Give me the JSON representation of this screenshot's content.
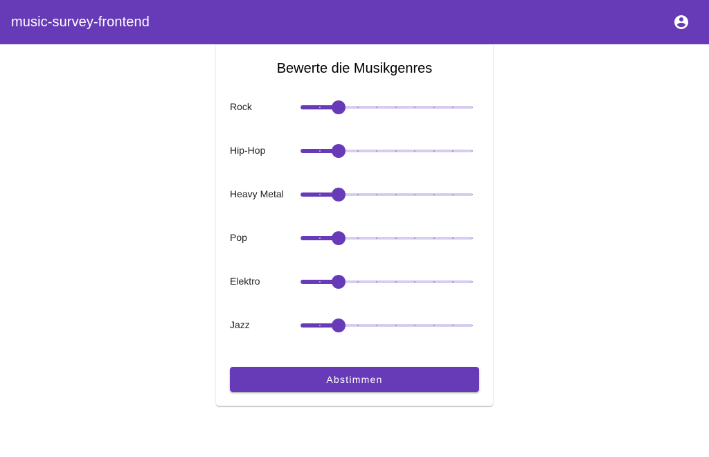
{
  "header": {
    "title": "music-survey-frontend",
    "account_icon": "account-circle-icon"
  },
  "form": {
    "title": "Bewerte die Musikgenres",
    "slider_scale": {
      "min": 0,
      "max": 9,
      "step": 1
    },
    "genres": [
      {
        "label": "Rock",
        "value": 2
      },
      {
        "label": "Hip-Hop",
        "value": 2
      },
      {
        "label": "Heavy Metal",
        "value": 2
      },
      {
        "label": "Pop",
        "value": 2
      },
      {
        "label": "Elektro",
        "value": 2
      },
      {
        "label": "Jazz",
        "value": 2
      }
    ],
    "submit_label": "Abstimmen"
  },
  "colors": {
    "primary": "#673ab7",
    "track_inactive": "#d9cdef"
  }
}
